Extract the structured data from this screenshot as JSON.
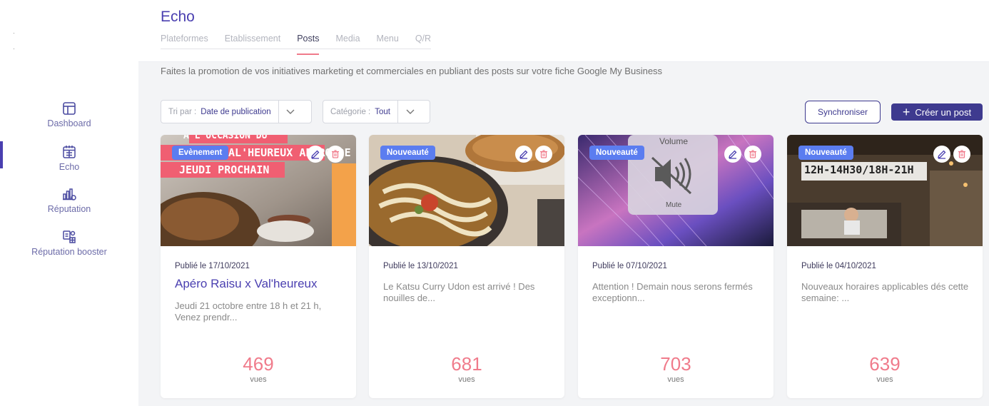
{
  "sidebar": {
    "items": [
      {
        "label": "Dashboard",
        "icon": "layout-icon"
      },
      {
        "label": "Echo",
        "icon": "calendar-icon"
      },
      {
        "label": "Réputation",
        "icon": "reputation-icon"
      },
      {
        "label": "Réputation booster",
        "icon": "reputation-booster-icon"
      }
    ],
    "active": "Echo"
  },
  "header": {
    "title": "Echo",
    "tabs": [
      {
        "label": "Plateformes"
      },
      {
        "label": "Etablissement"
      },
      {
        "label": "Posts"
      },
      {
        "label": "Media"
      },
      {
        "label": "Menu"
      },
      {
        "label": "Q/R"
      }
    ],
    "active_tab": "Posts"
  },
  "intro": "Faites la promotion de vos initiatives marketing et commerciales en publiant des posts sur votre fiche Google My Business",
  "toolbar": {
    "sort_label": "Tri par :",
    "sort_value": "Date de publication",
    "category_label": "Catégorie :",
    "category_value": "Tout",
    "sync_label": "Synchroniser",
    "create_label": "Créer un post"
  },
  "posts": [
    {
      "badge": "Evènement",
      "image_text": [
        "A L'OCCASION DU",
        "VAL'HEUREUX APÉRO DE",
        "JEUDI PROCHAIN"
      ],
      "date": "Publié le 17/10/2021",
      "title": "Apéro Raisu x Val'heureux",
      "snippet": "Jeudi 21 octobre entre 18 h et 21 h, Venez prendr...",
      "views": "469",
      "views_label": "vues"
    },
    {
      "badge": "Nouveauté",
      "date": "Publié le 13/10/2021",
      "title": "",
      "snippet": "Le Katsu Curry Udon est arrivé ! Des nouilles de...",
      "views": "681",
      "views_label": "vues"
    },
    {
      "badge": "Nouveauté",
      "image_text": [
        "Volume",
        "Mute"
      ],
      "date": "Publié le 07/10/2021",
      "title": "",
      "snippet": "Attention ! Demain nous serons fermés exceptionn...",
      "views": "703",
      "views_label": "vues"
    },
    {
      "badge": "Nouveauté",
      "image_text": [
        "12H-14H30/18H-21H"
      ],
      "date": "Publié le 04/10/2021",
      "title": "",
      "snippet": "Nouveaux horaires applicables dés cette semaine: ...",
      "views": "639",
      "views_label": "vues"
    }
  ],
  "colors": {
    "brand": "#4a3fb0",
    "button": "#3e3a8f",
    "accent": "#f07b8b",
    "badge": "#5b7df0"
  }
}
